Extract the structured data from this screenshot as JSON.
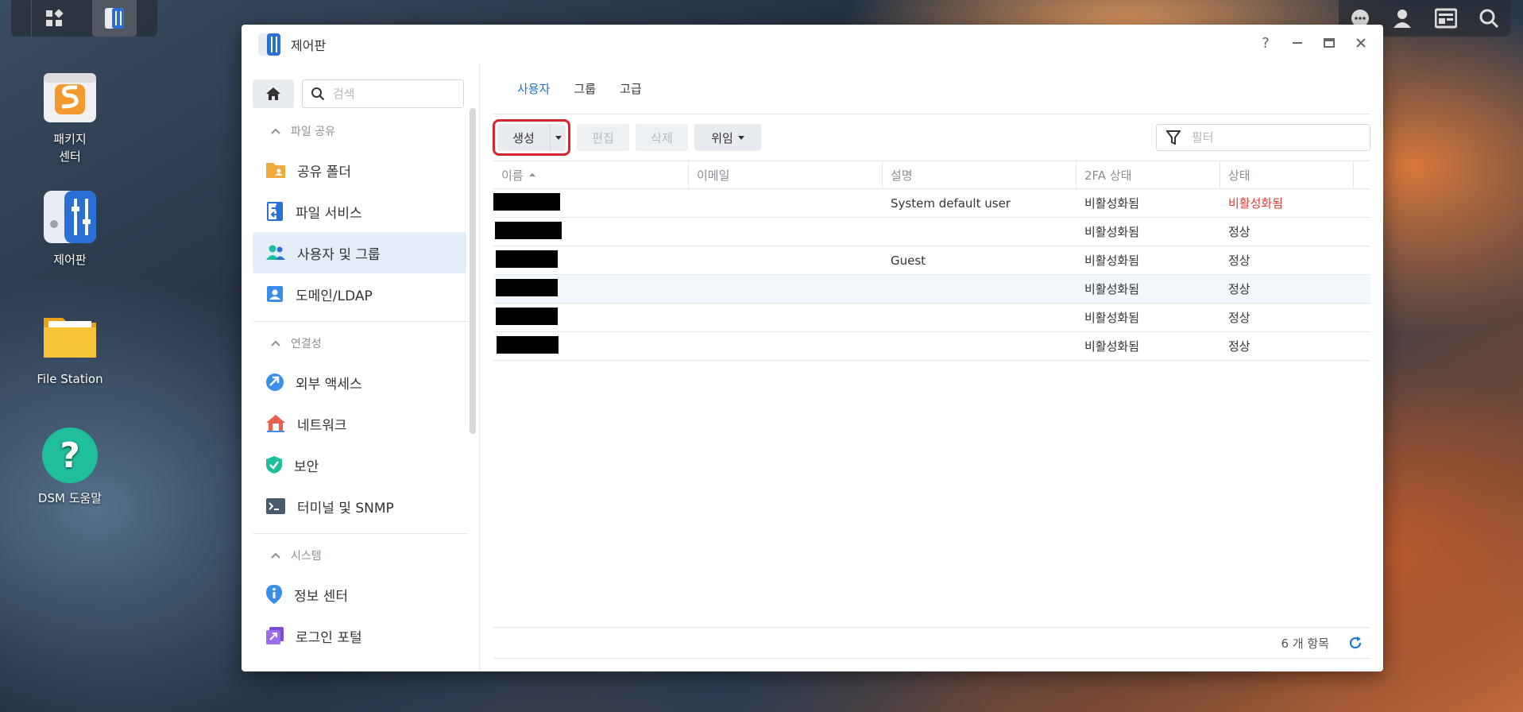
{
  "window": {
    "title": "제어판"
  },
  "desktop": [
    {
      "label_line1": "패키지",
      "label_line2": "센터"
    },
    {
      "label_line1": "제어판"
    },
    {
      "label_line1": "File Station"
    },
    {
      "label_line1": "DSM 도움말"
    }
  ],
  "sidebar": {
    "search_placeholder": "검색",
    "sections": [
      {
        "label": "파일 공유",
        "items": [
          "공유 폴더",
          "파일 서비스",
          "사용자 및 그룹",
          "도메인/LDAP"
        ]
      },
      {
        "label": "연결성",
        "items": [
          "외부 액세스",
          "네트워크",
          "보안",
          "터미널 및 SNMP"
        ]
      },
      {
        "label": "시스템",
        "items": [
          "정보 센터",
          "로그인 포털"
        ]
      }
    ],
    "active_item": "사용자 및 그룹"
  },
  "tabs": [
    {
      "label": "사용자",
      "active": true
    },
    {
      "label": "그룹",
      "active": false
    },
    {
      "label": "고급",
      "active": false
    }
  ],
  "toolbar": {
    "create": "생성",
    "edit": "편집",
    "delete": "삭제",
    "delegate": "위임",
    "filter_placeholder": "필터"
  },
  "table": {
    "columns": [
      "이름",
      "이메일",
      "설명",
      "2FA 상태",
      "상태"
    ],
    "rows": [
      {
        "name": "[redacted]",
        "email": "",
        "description": "System default user",
        "twofa": "비활성화됨",
        "status": "비활성화됨"
      },
      {
        "name": "[redacted]",
        "email": "",
        "description": "",
        "twofa": "비활성화됨",
        "status": "정상"
      },
      {
        "name": "[redacted]",
        "email": "",
        "description": "Guest",
        "twofa": "비활성화됨",
        "status": "정상"
      },
      {
        "name": "[redacted]",
        "email": "",
        "description": "",
        "twofa": "비활성화됨",
        "status": "정상"
      },
      {
        "name": "[redacted]",
        "email": "",
        "description": "",
        "twofa": "비활성화됨",
        "status": "정상"
      },
      {
        "name": "[redacted]",
        "email": "",
        "description": "",
        "twofa": "비활성화됨",
        "status": "정상"
      }
    ]
  },
  "footer": {
    "count": "6 개 항목"
  },
  "colors": {
    "accent": "#1a76d2",
    "highlight": "#d9232d",
    "danger": "#e53935"
  }
}
